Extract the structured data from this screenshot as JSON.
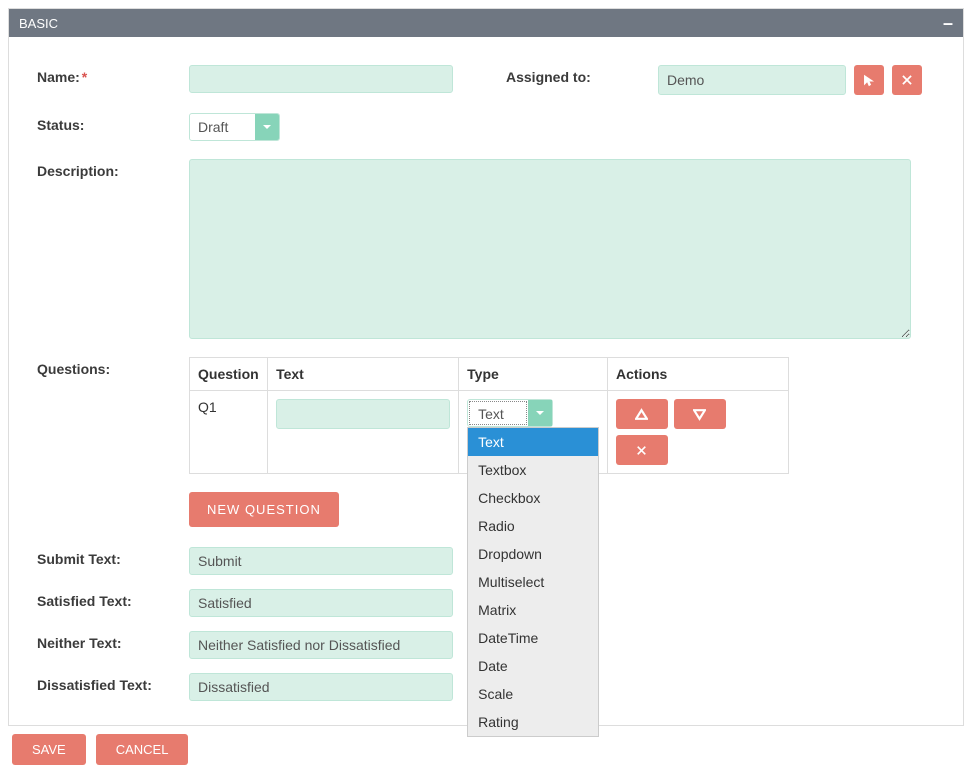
{
  "panel": {
    "title": "BASIC"
  },
  "labels": {
    "name": "Name:",
    "assigned_to": "Assigned to:",
    "status": "Status:",
    "description": "Description:",
    "questions": "Questions:",
    "submit_text": "Submit Text:",
    "satisfied_text": "Satisfied Text:",
    "neither_text": "Neither Text:",
    "dissatisfied_text": "Dissatisfied Text:"
  },
  "fields": {
    "name": "",
    "assigned_to": "Demo",
    "status": "Draft",
    "description": "",
    "submit_text": "Submit",
    "satisfied_text": "Satisfied",
    "neither_text": "Neither Satisfied nor Dissatisfied",
    "dissatisfied_text": "Dissatisfied"
  },
  "questions_table": {
    "headers": {
      "question": "Question",
      "text": "Text",
      "type": "Type",
      "actions": "Actions"
    },
    "rows": [
      {
        "id": "Q1",
        "text": "",
        "type": "Text"
      }
    ]
  },
  "type_options": [
    "Text",
    "Textbox",
    "Checkbox",
    "Radio",
    "Dropdown",
    "Multiselect",
    "Matrix",
    "DateTime",
    "Date",
    "Scale",
    "Rating"
  ],
  "buttons": {
    "new_question": "NEW QUESTION",
    "save": "SAVE",
    "cancel": "CANCEL"
  },
  "colors": {
    "accent_mint": "#d9f0e7",
    "accent_coral": "#e77b6e",
    "header_grey": "#6f7782",
    "select_highlight": "#2a90d6"
  }
}
